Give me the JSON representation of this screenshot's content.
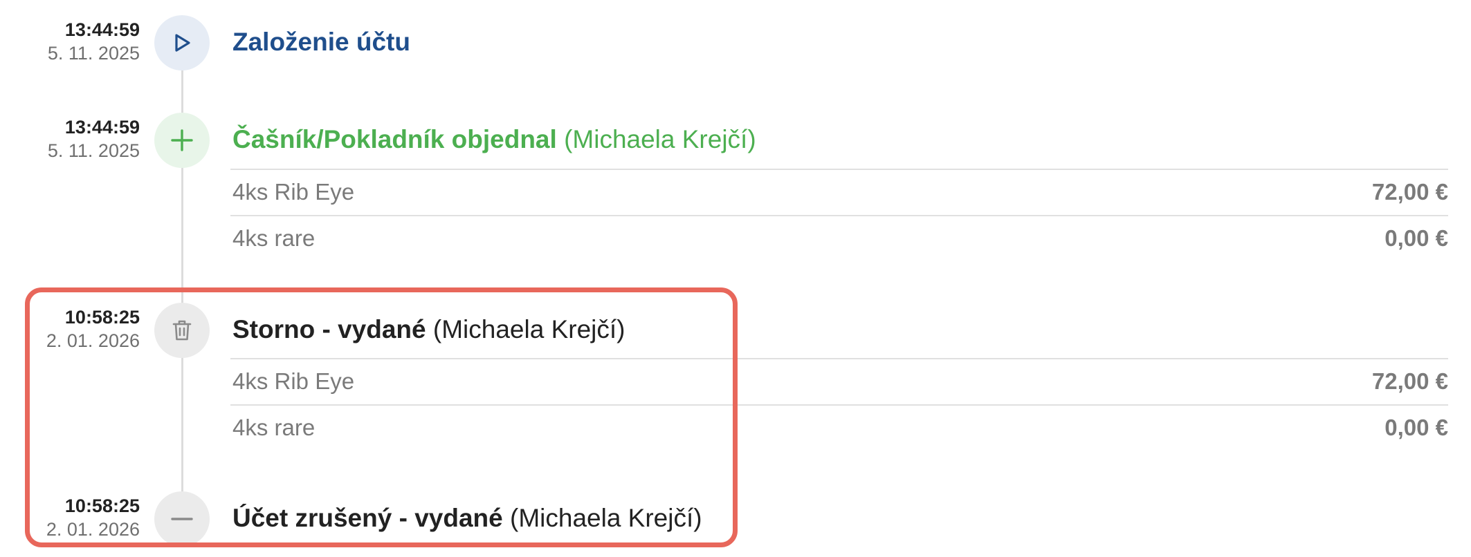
{
  "events": [
    {
      "time": "13:44:59",
      "date": "5. 11. 2025",
      "icon": "play-icon",
      "title": "Založenie účtu",
      "color": "#1f4e8c"
    },
    {
      "time": "13:44:59",
      "date": "5. 11. 2025",
      "icon": "plus-icon",
      "title": "Čašník/Pokladník objednal",
      "user": "(Michaela Krejčí)",
      "color": "#4caf50",
      "items": [
        {
          "name": "4ks Rib Eye",
          "price": "72,00 €"
        },
        {
          "name": "4ks rare",
          "price": "0,00 €"
        }
      ]
    },
    {
      "time": "10:58:25",
      "date": "2. 01. 2026",
      "icon": "trash-icon",
      "title": "Storno - vydané",
      "user": "(Michaela Krejčí)",
      "color": "#222222",
      "items": [
        {
          "name": "4ks Rib Eye",
          "price": "72,00 €"
        },
        {
          "name": "4ks rare",
          "price": "0,00 €"
        }
      ]
    },
    {
      "time": "10:58:25",
      "date": "2. 01. 2026",
      "icon": "minus-icon",
      "title": "Účet zrušený - vydané",
      "user": "(Michaela Krejčí)",
      "color": "#222222"
    }
  ],
  "highlight_color": "#e8675b"
}
